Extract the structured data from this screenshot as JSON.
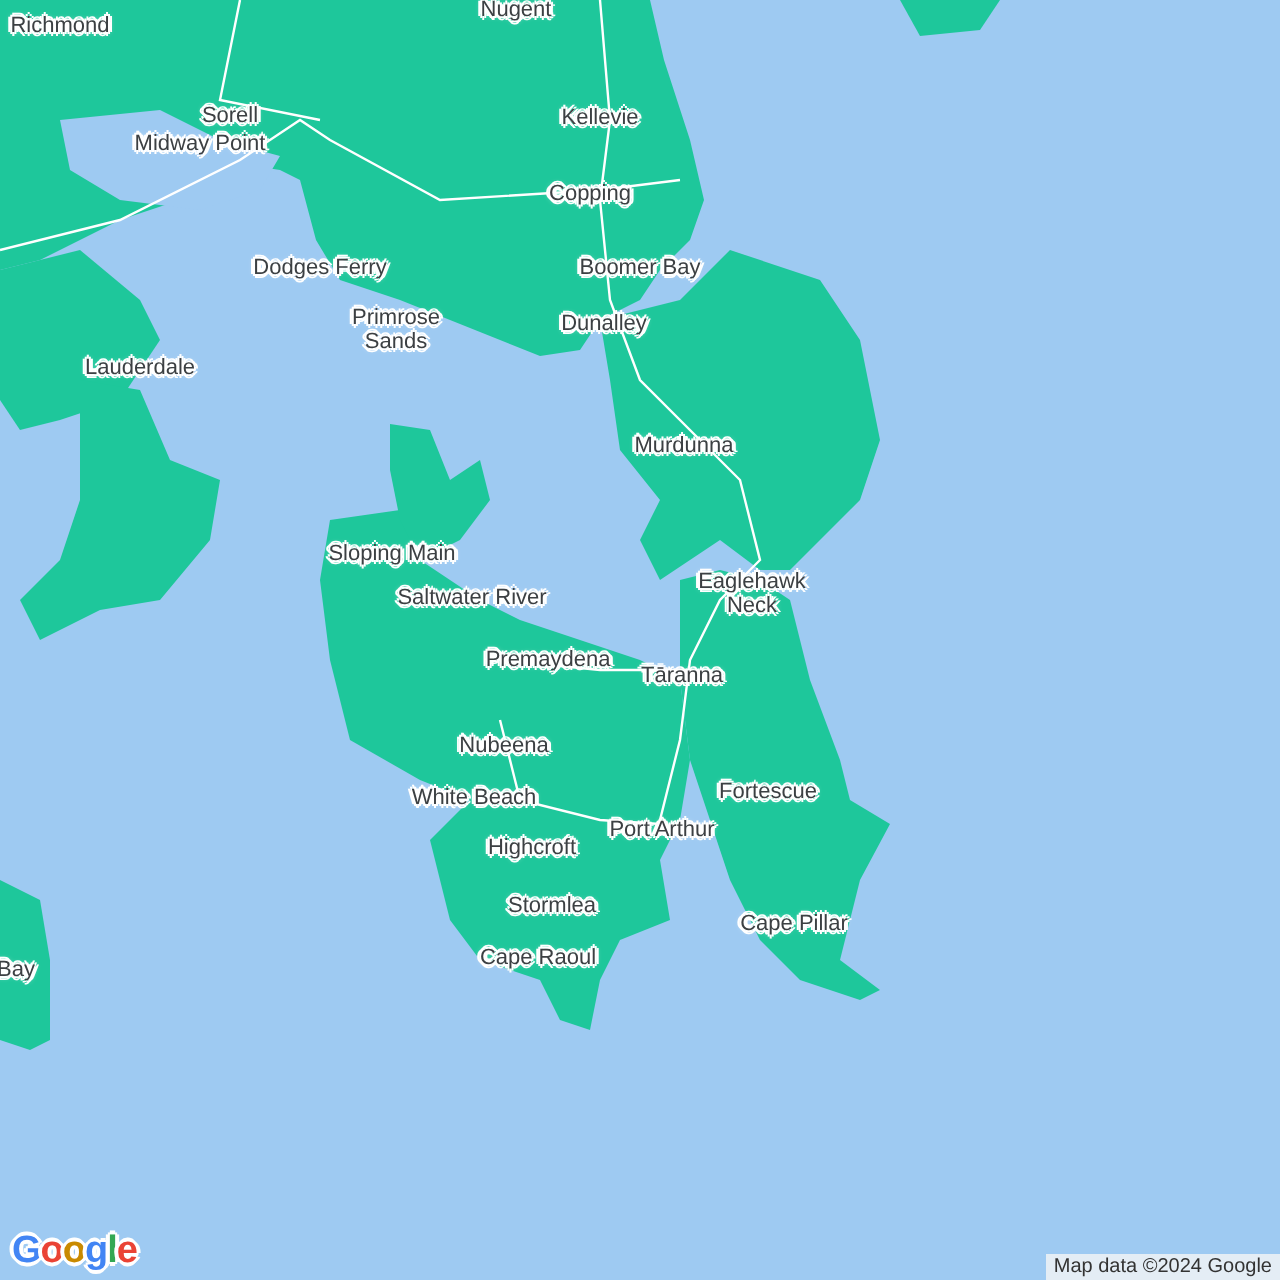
{
  "map": {
    "labels": [
      {
        "text": "Nugent"
      },
      {
        "text": "Richmond"
      },
      {
        "text": "Sorell"
      },
      {
        "text": "Midway Point"
      },
      {
        "text": "Kellevie"
      },
      {
        "text": "Copping"
      },
      {
        "text": "Dodges Ferry"
      },
      {
        "text": "Boomer Bay"
      },
      {
        "text": "Primrose Sands"
      },
      {
        "text": "Dunalley"
      },
      {
        "text": "Lauderdale"
      },
      {
        "text": "Murdunna"
      },
      {
        "text": "Sloping Main"
      },
      {
        "text": "Saltwater River"
      },
      {
        "text": "Eaglehawk Neck"
      },
      {
        "text": "Premaydena"
      },
      {
        "text": "Tāranna"
      },
      {
        "text": "Nubeena"
      },
      {
        "text": "Fortescue"
      },
      {
        "text": "White Beach"
      },
      {
        "text": "Port Arthur"
      },
      {
        "text": "Highcroft"
      },
      {
        "text": "Stormlea"
      },
      {
        "text": "Cape Pillar"
      },
      {
        "text": "Cape Raoul"
      },
      {
        "text": "Bay"
      }
    ]
  },
  "logo": "Google",
  "attribution": "Map data ©2024 Google"
}
